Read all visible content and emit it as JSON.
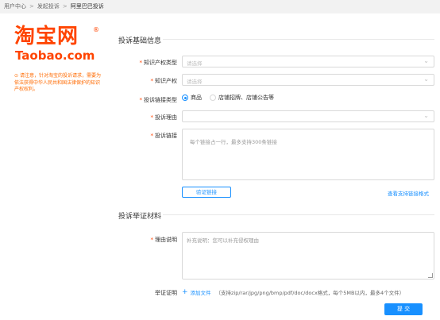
{
  "breadcrumb": {
    "items": [
      "用户中心",
      "发起投诉",
      "阿里巴巴投诉"
    ],
    "separator": ">"
  },
  "logo": {
    "cn": "淘宝网",
    "reg": "®",
    "en": "Taobao.com",
    "color": "#ff4400"
  },
  "notice": {
    "icon": "info-circle-icon",
    "text": "请注意，针对淘宝的投诉请求，需要为依法获得中华人民共和国法律保护的知识产权权利。"
  },
  "section_basic": {
    "title": "投诉基础信息"
  },
  "fields": {
    "ip_type": {
      "label": "知识产权类型",
      "placeholder": "请选择"
    },
    "ip": {
      "label": "知识产权",
      "placeholder": "请选择"
    },
    "link_type": {
      "label": "投诉链接类型",
      "options": [
        "商品",
        "店铺招牌、店铺公告等"
      ],
      "selected": "商品"
    },
    "reason": {
      "label": "投诉理由",
      "placeholder": ""
    },
    "links": {
      "label": "投诉链接",
      "placeholder": "每个链接占一行，最多支持300条链接"
    }
  },
  "verify_button": "验证链接",
  "help_link": "查看支持链接格式",
  "section_evidence": {
    "title": "投诉举证材料"
  },
  "evidence": {
    "reason_desc": {
      "label": "理由说明",
      "placeholder": "补充说明：您可以补充侵权理由"
    },
    "proof": {
      "label": "举证证明",
      "upload_label": "添加文件",
      "hint": "（支持zip/rar/jpg/png/bmp/pdf/doc/docx格式，每个5MB以内，最多4个文件）"
    }
  },
  "submit_button": "提 交",
  "colors": {
    "accent": "#1890ff",
    "required": "#ff4400",
    "notice": "#ff6a00"
  }
}
